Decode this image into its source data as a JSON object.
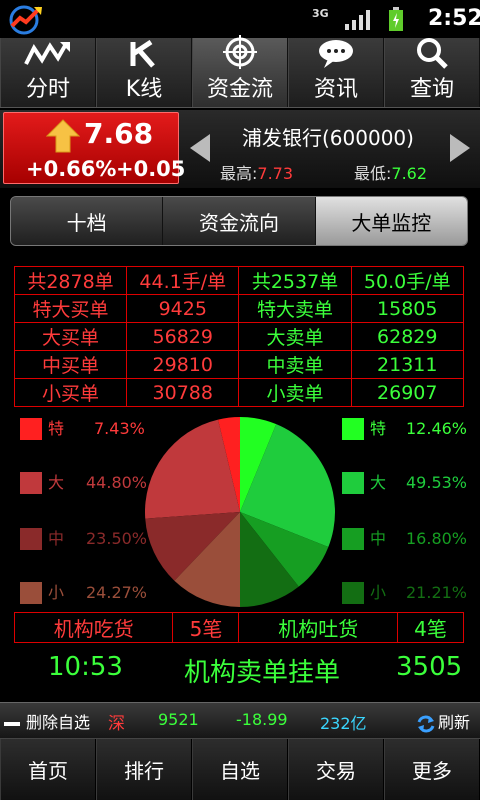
{
  "status": {
    "network": "3G",
    "time": "2:52"
  },
  "topnav": [
    {
      "label": "分时",
      "icon": "intraday-chart-icon"
    },
    {
      "label": "K线",
      "icon": "k-line-icon"
    },
    {
      "label": "资金流",
      "icon": "fund-flow-target-icon"
    },
    {
      "label": "资讯",
      "icon": "news-bubble-icon"
    },
    {
      "label": "查询",
      "icon": "search-icon"
    }
  ],
  "quote": {
    "price": "7.68",
    "pct": "+0.66%",
    "change": "+0.05",
    "name": "浦发银行(600000)",
    "high_label": "最高:",
    "high": "7.73",
    "low_label": "最低:",
    "low": "7.62"
  },
  "segments": [
    "十档",
    "资金流向",
    "大单监控"
  ],
  "table": {
    "header": [
      "共2878单",
      "44.1手/单",
      "共2537单",
      "50.0手/单"
    ],
    "rows": [
      {
        "buy_label": "特大买单",
        "buy": "9425",
        "sell_label": "特大卖单",
        "sell": "15805"
      },
      {
        "buy_label": "大买单",
        "buy": "56829",
        "sell_label": "大卖单",
        "sell": "62829"
      },
      {
        "buy_label": "中买单",
        "buy": "29810",
        "sell_label": "中卖单",
        "sell": "21311"
      },
      {
        "buy_label": "小买单",
        "buy": "30788",
        "sell_label": "小卖单",
        "sell": "26907"
      }
    ]
  },
  "legend": {
    "buy": [
      {
        "name": "特",
        "value": "7.43%",
        "color": "#ff2020"
      },
      {
        "name": "大",
        "value": "44.80%",
        "color": "#c0393c"
      },
      {
        "name": "中",
        "value": "23.50%",
        "color": "#8a2a2a"
      },
      {
        "name": "小",
        "value": "24.27%",
        "color": "#9a4e3a"
      }
    ],
    "sell": [
      {
        "name": "特",
        "value": "12.46%",
        "color": "#22ff22"
      },
      {
        "name": "大",
        "value": "49.53%",
        "color": "#1fcc3d"
      },
      {
        "name": "中",
        "value": "16.80%",
        "color": "#169e22"
      },
      {
        "name": "小",
        "value": "21.21%",
        "color": "#136e13"
      }
    ]
  },
  "chart_data": {
    "type": "pie",
    "series": [
      {
        "name": "买",
        "values": [
          7.43,
          44.8,
          23.5,
          24.27
        ],
        "categories": [
          "特",
          "大",
          "中",
          "小"
        ]
      },
      {
        "name": "卖",
        "values": [
          12.46,
          49.53,
          16.8,
          21.21
        ],
        "categories": [
          "特",
          "大",
          "中",
          "小"
        ]
      }
    ]
  },
  "institution": {
    "buy_label": "机构吃货",
    "buy_count": "5笔",
    "sell_label": "机构吐货",
    "sell_count": "4笔"
  },
  "summary": {
    "time": "10:53",
    "message": "机构卖单挂单",
    "volume": "3505"
  },
  "ticker": {
    "delete_label": "删除自选",
    "market": "深",
    "index": "9521",
    "change": "-18.99",
    "volume": "232亿",
    "refresh_label": "刷新"
  },
  "bottomnav": [
    "首页",
    "排行",
    "自选",
    "交易",
    "更多"
  ]
}
